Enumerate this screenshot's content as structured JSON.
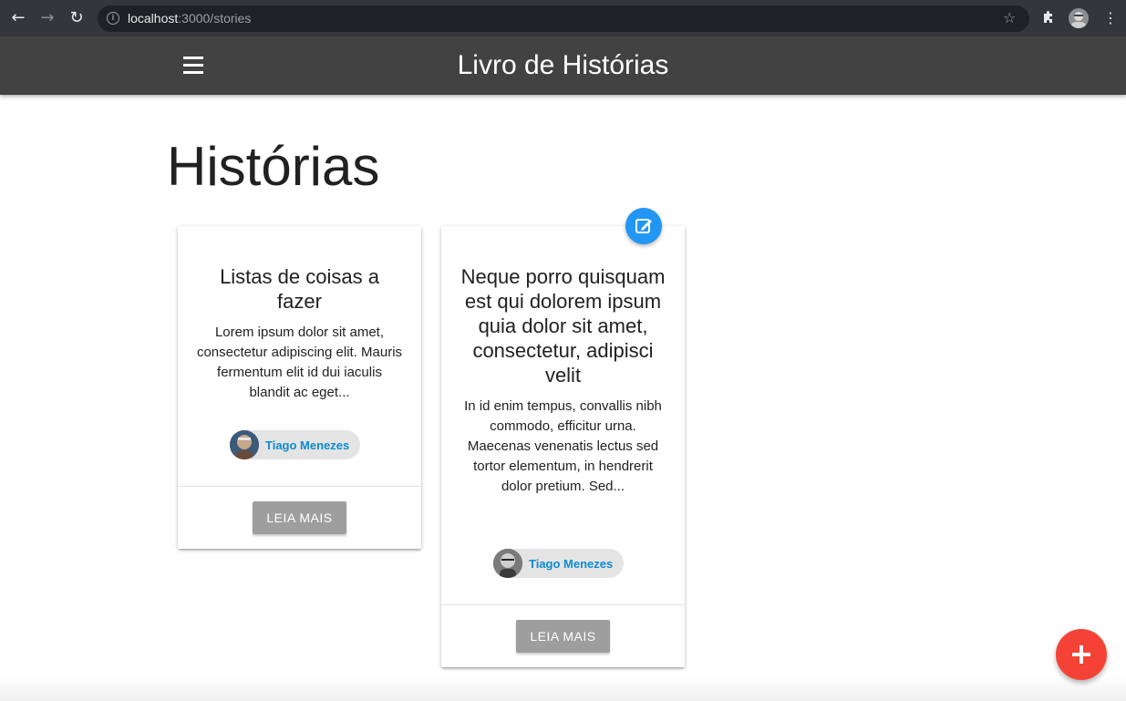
{
  "browser": {
    "url_host": "localhost",
    "url_path": ":3000/stories"
  },
  "app_bar": {
    "title": "Livro de Histórias"
  },
  "page": {
    "title": "Histórias"
  },
  "cards": [
    {
      "title": "Listas de coisas a fazer",
      "text": "Lorem ipsum dolor sit amet, consectetur adipiscing elit. Mauris fermentum elit id dui iaculis blandit ac eget...",
      "author": "Tiago Menezes",
      "button": "LEIA MAIS"
    },
    {
      "title": "Neque porro quisquam est qui dolorem ipsum quia dolor sit amet, consectetur, adipisci velit",
      "text": "In id enim tempus, convallis nibh commodo, efficitur urna. Maecenas venenatis lectus sed tortor elementum, in hendrerit dolor pretium. Sed...",
      "author": "Tiago Menezes",
      "button": "LEIA MAIS"
    }
  ],
  "colors": {
    "app_bar": "#424242",
    "edit_fab": "#2196f3",
    "add_fab": "#f44336",
    "author_link": "#0b8ccf",
    "button": "#9e9e9e"
  },
  "icons": {
    "back": "arrow-left-icon",
    "forward": "arrow-right-icon",
    "reload": "reload-icon",
    "menu": "hamburger-icon",
    "edit": "edit-icon",
    "add": "plus-icon"
  }
}
